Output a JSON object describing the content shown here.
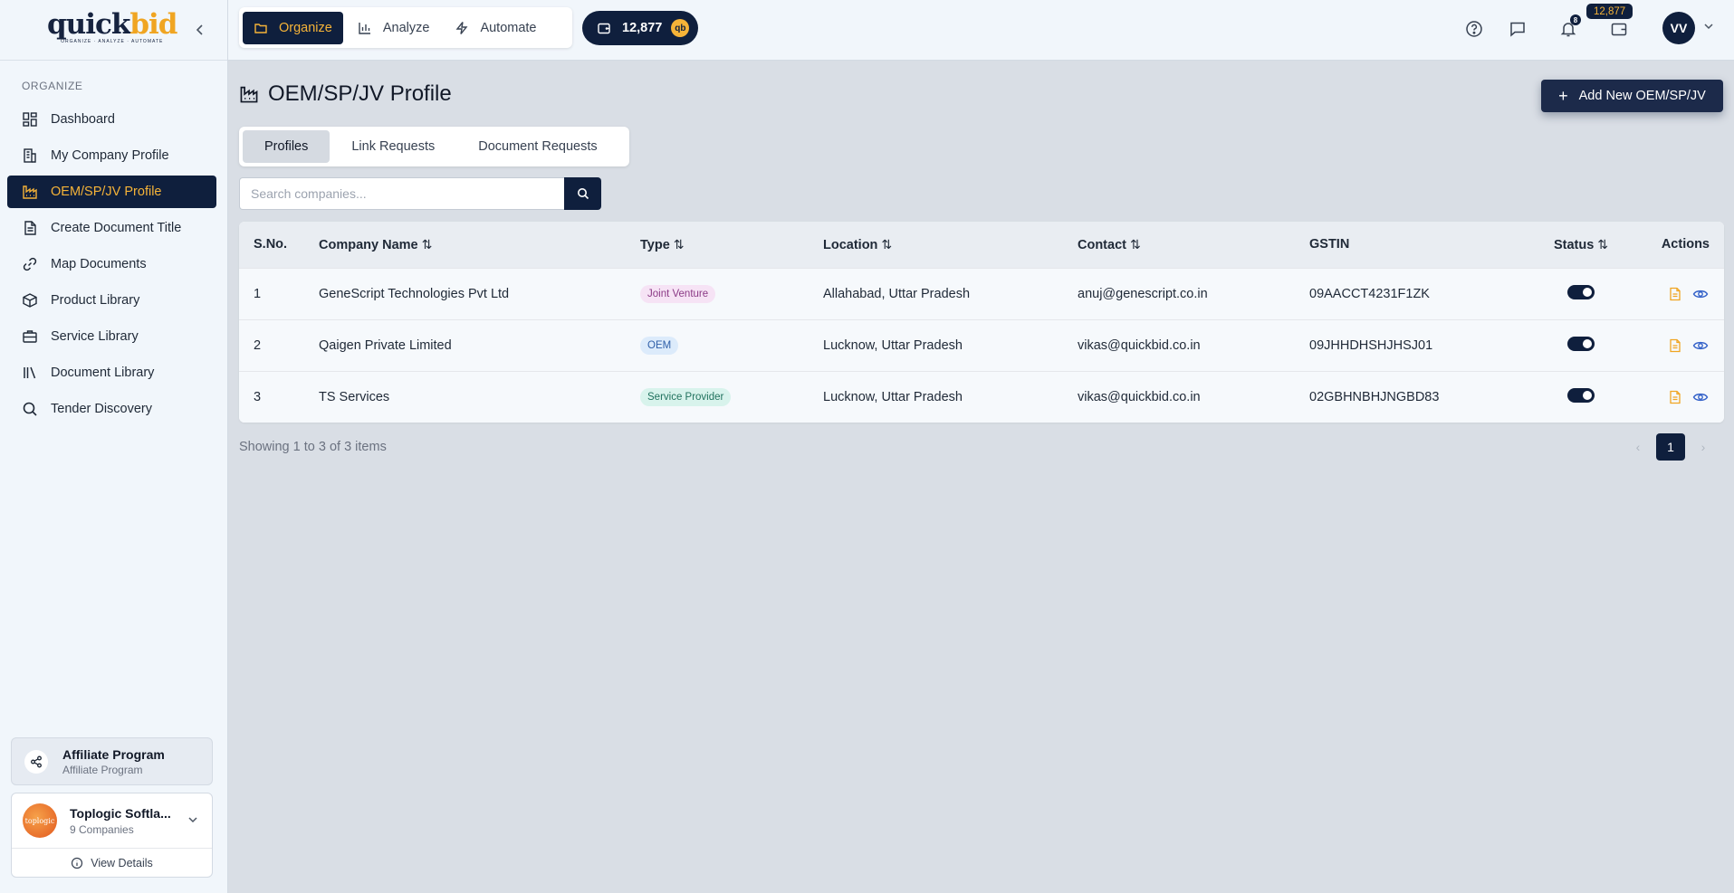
{
  "brand": {
    "logo_main": "quick",
    "logo_accent": "bid",
    "tagline": "ORGANIZE · ANALYZE · AUTOMATE"
  },
  "sidebar": {
    "section_label": "ORGANIZE",
    "items": [
      {
        "label": "Dashboard",
        "icon": "dashboard-grid-icon"
      },
      {
        "label": "My Company Profile",
        "icon": "building-icon"
      },
      {
        "label": "OEM/SP/JV Profile",
        "icon": "factory-icon",
        "active": true
      },
      {
        "label": "Create Document Title",
        "icon": "document-icon"
      },
      {
        "label": "Map Documents",
        "icon": "link-icon"
      },
      {
        "label": "Product Library",
        "icon": "package-icon"
      },
      {
        "label": "Service Library",
        "icon": "briefcase-icon"
      },
      {
        "label": "Document Library",
        "icon": "library-icon"
      },
      {
        "label": "Tender Discovery",
        "icon": "search-icon"
      }
    ],
    "affiliate": {
      "title": "Affiliate Program",
      "subtitle": "Affiliate Program"
    },
    "company": {
      "name": "Toplogic Softla...",
      "count": "9 Companies",
      "logo_text": "toplogic",
      "view_details": "View Details"
    }
  },
  "topbar": {
    "modes": [
      {
        "label": "Organize",
        "active": true
      },
      {
        "label": "Analyze"
      },
      {
        "label": "Automate"
      }
    ],
    "credits": "12,877",
    "coin_label": "qb",
    "notifications_count": "8",
    "wallet_badge": "12,877",
    "avatar_initials": "VV"
  },
  "page": {
    "title": "OEM/SP/JV Profile",
    "add_button": "Add New OEM/SP/JV",
    "tabs": [
      {
        "label": "Profiles",
        "active": true
      },
      {
        "label": "Link Requests"
      },
      {
        "label": "Document Requests"
      }
    ],
    "search_placeholder": "Search companies...",
    "search_value": ""
  },
  "table": {
    "columns": [
      {
        "label": "S.No.",
        "sortable": false
      },
      {
        "label": "Company Name",
        "sortable": true
      },
      {
        "label": "Type",
        "sortable": true
      },
      {
        "label": "Location",
        "sortable": true
      },
      {
        "label": "Contact",
        "sortable": true
      },
      {
        "label": "GSTIN",
        "sortable": false
      },
      {
        "label": "Status",
        "sortable": true
      },
      {
        "label": "Actions",
        "sortable": false
      }
    ],
    "rows": [
      {
        "sno": "1",
        "company": "GeneScript Technologies Pvt Ltd",
        "type": "Joint Venture",
        "location": "Allahabad, Uttar Pradesh",
        "contact": "anuj@genescript.co.in",
        "gstin": "09AACCT4231F1ZK",
        "status_on": true
      },
      {
        "sno": "2",
        "company": "Qaigen Private Limited",
        "type": "OEM",
        "location": "Lucknow, Uttar Pradesh",
        "contact": "vikas@quickbid.co.in",
        "gstin": "09JHHDHSHJHSJ01",
        "status_on": true
      },
      {
        "sno": "3",
        "company": "TS Services",
        "type": "Service Provider",
        "location": "Lucknow, Uttar Pradesh",
        "contact": "vikas@quickbid.co.in",
        "gstin": "02GBHNBHJNGBD83",
        "status_on": true
      }
    ],
    "type_colors": {
      "Joint Venture": {
        "bg": "#f6e3f5",
        "fg": "#8b3a86"
      },
      "OEM": {
        "bg": "#dcebfb",
        "fg": "#2f5fa8"
      },
      "Service Provider": {
        "bg": "#d8f3ec",
        "fg": "#21725e"
      }
    },
    "sort_glyph": "⇅"
  },
  "footer": {
    "showing": "Showing 1 to 3 of 3 items",
    "current_page": "1",
    "prev": "‹",
    "next": "›"
  },
  "colors": {
    "navy": "#0f1f3d",
    "accent": "#f5b338",
    "doc_icon": "#f0a522",
    "view_icon": "#3563c9"
  }
}
